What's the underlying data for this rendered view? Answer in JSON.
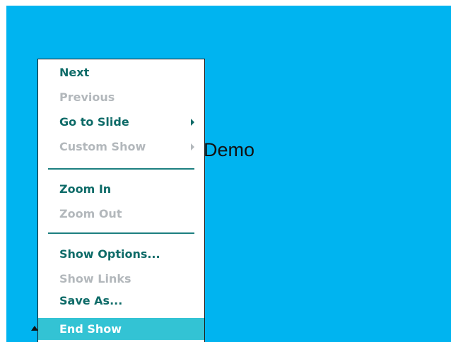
{
  "slide": {
    "title_visible": "Demo"
  },
  "context_menu": {
    "items": [
      {
        "label": "Next",
        "enabled": true
      },
      {
        "label": "Previous",
        "enabled": false
      },
      {
        "label": "Go to Slide",
        "enabled": true,
        "submenu": true
      },
      {
        "label": "Custom Show",
        "enabled": false,
        "submenu": true
      },
      {
        "label": "Zoom In",
        "enabled": true
      },
      {
        "label": "Zoom Out",
        "enabled": false
      },
      {
        "label": "Show Options...",
        "enabled": true
      },
      {
        "label": "Show Links",
        "enabled": false
      },
      {
        "label": "Save As...",
        "enabled": true
      },
      {
        "label": "End Show",
        "enabled": true,
        "highlighted": true
      }
    ],
    "icons": {
      "submenu_arrow": "chevron-right-icon"
    }
  },
  "colors": {
    "slide_background": "#00b4f0",
    "menu_text_enabled": "#0e6b68",
    "menu_text_disabled": "#b3b8bc",
    "menu_highlight": "#33c3d4",
    "separator": "#1c7f80"
  }
}
